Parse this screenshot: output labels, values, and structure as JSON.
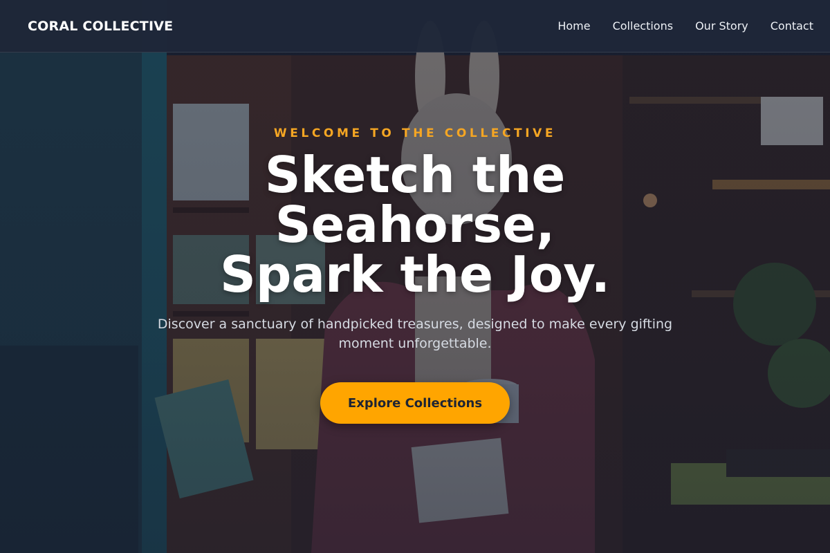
{
  "nav": {
    "brand": "CORAL COLLECTIVE",
    "links": [
      "Home",
      "Collections",
      "Our Story",
      "Contact"
    ]
  },
  "hero": {
    "eyebrow": "WELCOME TO THE COLLECTIVE",
    "title": "Sketch the Seahorse, Spark the Joy.",
    "subtitle": "Discover a sanctuary of handpicked treasures, designed to make every gifting moment unforgettable.",
    "cta_label": "Explore Collections"
  },
  "colors": {
    "accent": "#ffa500",
    "eyebrow": "#f5a623",
    "navbar": "#1e2638"
  }
}
